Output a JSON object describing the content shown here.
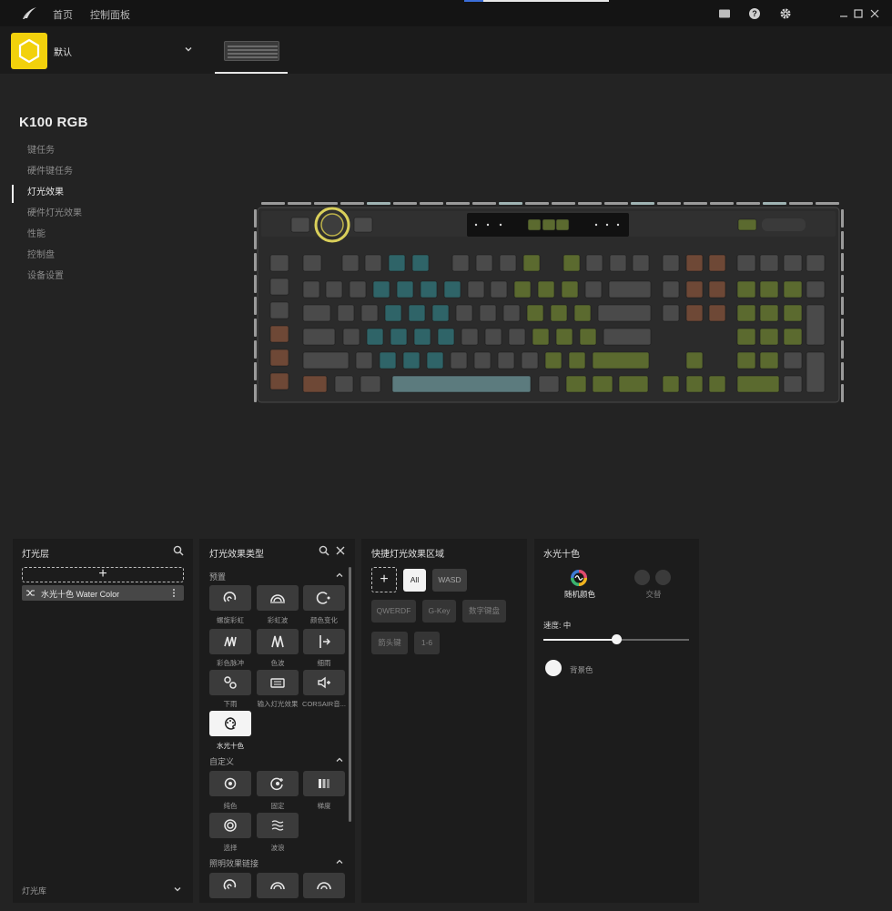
{
  "titlebar": {
    "nav": [
      "首页",
      "控制面板"
    ]
  },
  "profile": {
    "name": "默认"
  },
  "device": {
    "name": "K100 RGB"
  },
  "menu": [
    {
      "label": "键任务",
      "active": false
    },
    {
      "label": "硬件键任务",
      "active": false
    },
    {
      "label": "灯光效果",
      "active": true
    },
    {
      "label": "硬件灯光效果",
      "active": false
    },
    {
      "label": "性能",
      "active": false
    },
    {
      "label": "控制盘",
      "active": false
    },
    {
      "label": "设备设置",
      "active": false
    }
  ],
  "layers_panel": {
    "title": "灯光层",
    "layer": "水光十色  Water Color",
    "library": "灯光库"
  },
  "effects_panel": {
    "title": "灯光效果类型",
    "sections": {
      "preset": "预置",
      "custom": "自定义",
      "link": "照明效果链接"
    },
    "preset": [
      {
        "label": "螺旋彩虹",
        "icon": "spiral-rainbow-icon"
      },
      {
        "label": "彩虹波",
        "icon": "rainbow-wave-icon"
      },
      {
        "label": "颜色变化",
        "icon": "color-shift-icon"
      },
      {
        "label": "彩色脉冲",
        "icon": "color-pulse-icon"
      },
      {
        "label": "色波",
        "icon": "color-wave-icon"
      },
      {
        "label": "细雨",
        "icon": "visor-icon"
      },
      {
        "label": "下雨",
        "icon": "rain-icon"
      },
      {
        "label": "输入灯光效果",
        "icon": "keyboard-icon"
      },
      {
        "label": "CORSAIR音...",
        "icon": "audio-icon"
      },
      {
        "label": "水光十色",
        "icon": "palette-icon",
        "selected": true
      }
    ],
    "custom": [
      {
        "label": "纯色",
        "icon": "static-icon"
      },
      {
        "label": "固定",
        "icon": "ripple-icon"
      },
      {
        "label": "梯度",
        "icon": "gradient-icon"
      },
      {
        "label": "选择",
        "icon": "target-icon"
      },
      {
        "label": "波浪",
        "icon": "wave-icon"
      }
    ]
  },
  "zones_panel": {
    "title": "快捷灯光效果区域",
    "zones": [
      "All",
      "WASD",
      "QWERDF",
      "G-Key",
      "数字键盘",
      "箭头键",
      "1-6"
    ]
  },
  "settings_panel": {
    "title": "水光十色",
    "random_label": "随机颜色",
    "alternate_label": "交替",
    "speed_label": "速度:  中",
    "speed_fraction": 0.5,
    "bg_label": "背景色"
  },
  "colors": {
    "accent_yellow": "#f2d10c",
    "key_green": "#5b6a2f",
    "key_teal": "#2f6468",
    "key_brown": "#6e4836",
    "key_gray": "#4a4a4a"
  }
}
